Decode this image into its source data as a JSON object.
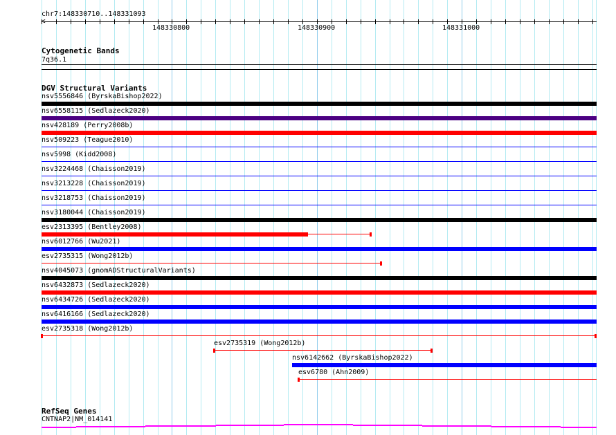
{
  "location": "chr7:148330710..148331093",
  "view": {
    "start": 148330710,
    "end": 148331093
  },
  "ruler_labels": [
    {
      "pos": 148330800,
      "label": "148330800"
    },
    {
      "pos": 148330900,
      "label": "148330900"
    },
    {
      "pos": 148331000,
      "label": "148331000"
    }
  ],
  "cytoband": {
    "title": "Cytogenetic Bands",
    "band": "7q36.1"
  },
  "dgv": {
    "title": "DGV Structural Variants",
    "variants": [
      {
        "label": "nsv5556846 (ByrskaBishop2022)",
        "start": 148330700,
        "end": 148331100,
        "style": "thick",
        "color": "#000000"
      },
      {
        "label": "nsv6558115 (Sedlazeck2020)",
        "start": 148330700,
        "end": 148331100,
        "style": "thick",
        "color": "#4b0082"
      },
      {
        "label": "nsv428189 (Perry2008b)",
        "start": 148330700,
        "end": 148331100,
        "style": "thick",
        "color": "#ff0000"
      },
      {
        "label": "nsv509223 (Teague2010)",
        "start": 148330700,
        "end": 148331100,
        "style": "line",
        "color": "#0000ff"
      },
      {
        "label": "nsv5998 (Kidd2008)",
        "start": 148330700,
        "end": 148331100,
        "style": "line",
        "color": "#0000ff"
      },
      {
        "label": "nsv3224468 (Chaisson2019)",
        "start": 148330700,
        "end": 148331100,
        "style": "line",
        "color": "#0000ff"
      },
      {
        "label": "nsv3213228 (Chaisson2019)",
        "start": 148330700,
        "end": 148331100,
        "style": "line",
        "color": "#0000ff"
      },
      {
        "label": "nsv3218753 (Chaisson2019)",
        "start": 148330700,
        "end": 148331100,
        "style": "line",
        "color": "#0000ff"
      },
      {
        "label": "nsv3180044 (Chaisson2019)",
        "start": 148330700,
        "end": 148331100,
        "style": "thick",
        "color": "#000000"
      },
      {
        "label": "esv2313395 (Bentley2008)",
        "start": 148330700,
        "end": 148330938,
        "thick_end": 148330894,
        "style": "mixed",
        "color": "#ff0000",
        "cap_end": true
      },
      {
        "label": "nsv6012766 (Wu2021)",
        "start": 148330700,
        "end": 148331100,
        "style": "thick",
        "color": "#0000ff"
      },
      {
        "label": "esv2735315 (Wong2012b)",
        "start": 148330700,
        "end": 148330945,
        "style": "line",
        "color": "#ff0000",
        "cap_end": true
      },
      {
        "label": "nsv4045073 (gnomADStructuralVariants)",
        "start": 148330700,
        "end": 148331100,
        "style": "thick",
        "color": "#000000"
      },
      {
        "label": "nsv6432873 (Sedlazeck2020)",
        "start": 148330700,
        "end": 148331100,
        "style": "thick",
        "color": "#ff0000"
      },
      {
        "label": "nsv6434726 (Sedlazeck2020)",
        "start": 148330700,
        "end": 148331100,
        "style": "thick",
        "color": "#0000ff"
      },
      {
        "label": "nsv6416166 (Sedlazeck2020)",
        "start": 148330700,
        "end": 148331100,
        "style": "thick",
        "color": "#0000ff"
      },
      {
        "label": "esv2735318 (Wong2012b)",
        "start": 148330710,
        "end": 148331093,
        "style": "line",
        "color": "#ff0000",
        "cap_start": true,
        "cap_end": true
      },
      {
        "label": "esv2735319 (Wong2012b)",
        "start": 148330829,
        "end": 148330980,
        "style": "line",
        "color": "#ff0000",
        "cap_start": true,
        "cap_end": true
      },
      {
        "label": "nsv6142662 (ByrskaBishop2022)",
        "start": 148330883,
        "end": 148331100,
        "style": "thick",
        "color": "#0000ff"
      },
      {
        "label": "esv6780 (Ahn2009)",
        "start": 148330887,
        "end": 148331100,
        "style": "line",
        "color": "#ff0000",
        "cap_start": true
      }
    ]
  },
  "refseq": {
    "title": "RefSeq Genes",
    "gene": "CNTNAP2|NM_014141",
    "color": "#ff00ff"
  }
}
